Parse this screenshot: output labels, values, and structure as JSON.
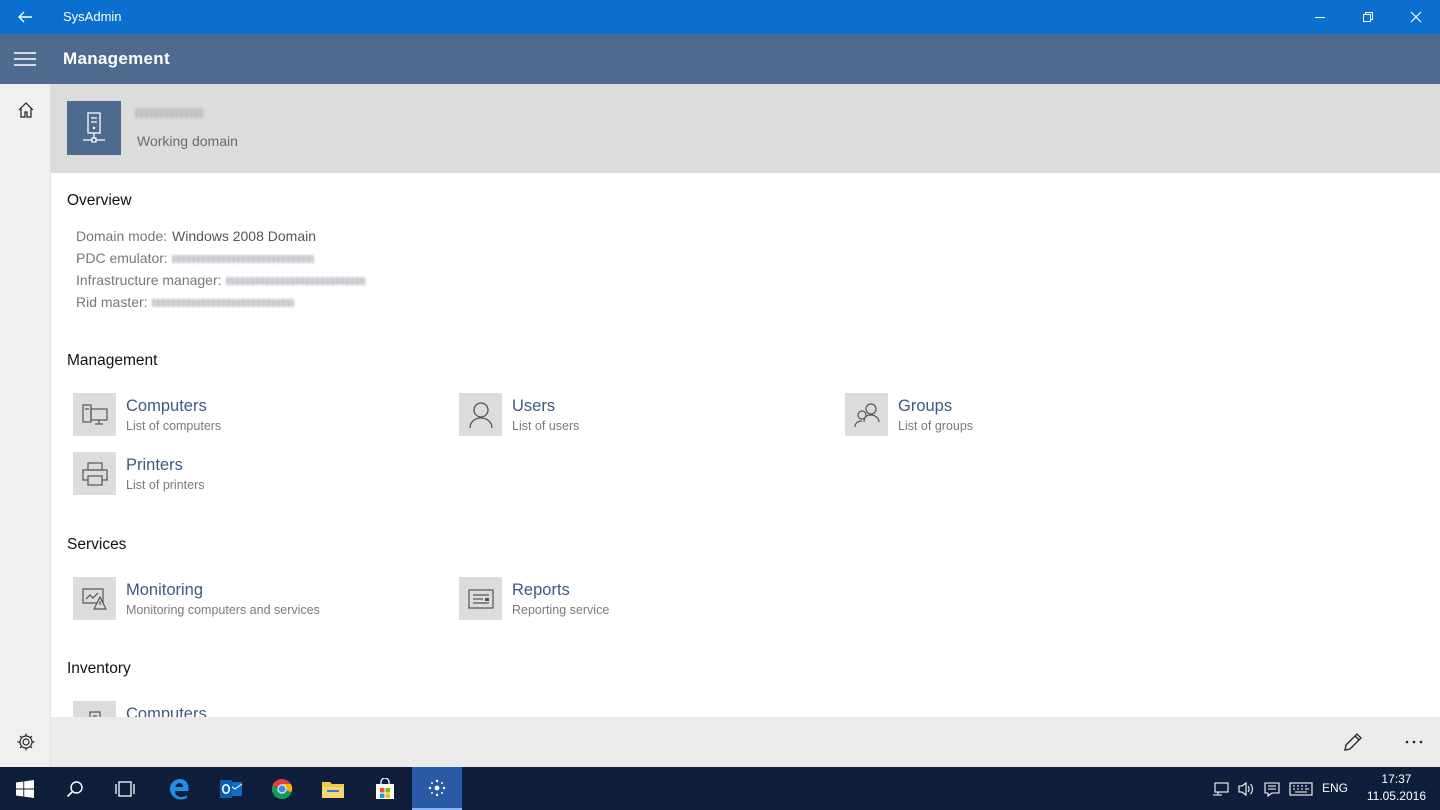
{
  "window": {
    "title": "SysAdmin"
  },
  "header": {
    "title": "Management"
  },
  "domain": {
    "subtitle": "Working domain"
  },
  "overview": {
    "heading": "Overview",
    "domain_mode_label": "Domain mode:",
    "domain_mode_value": "Windows 2008 Domain",
    "pdc_label": "PDC emulator:",
    "infra_label": "Infrastructure manager:",
    "rid_label": "Rid master:"
  },
  "management": {
    "heading": "Management",
    "items": [
      {
        "title": "Computers",
        "subtitle": "List of computers",
        "icon": "computers-icon"
      },
      {
        "title": "Users",
        "subtitle": "List of users",
        "icon": "user-icon"
      },
      {
        "title": "Groups",
        "subtitle": "List of groups",
        "icon": "groups-icon"
      },
      {
        "title": "Printers",
        "subtitle": "List of printers",
        "icon": "printer-icon"
      }
    ]
  },
  "services": {
    "heading": "Services",
    "items": [
      {
        "title": "Monitoring",
        "subtitle": "Monitoring computers and services",
        "icon": "monitoring-icon"
      },
      {
        "title": "Reports",
        "subtitle": "Reporting service",
        "icon": "reports-icon"
      }
    ]
  },
  "inventory": {
    "heading": "Inventory",
    "items": [
      {
        "title": "Computers",
        "icon": "computer-icon"
      }
    ]
  },
  "taskbar": {
    "lang": "ENG",
    "time": "17:37",
    "date": "11.05.2016"
  },
  "colors": {
    "titlebar": "#0a6fcf",
    "header": "#4e6a8e",
    "accent_text": "#3e5a80",
    "taskbar": "#0f1f3b"
  }
}
